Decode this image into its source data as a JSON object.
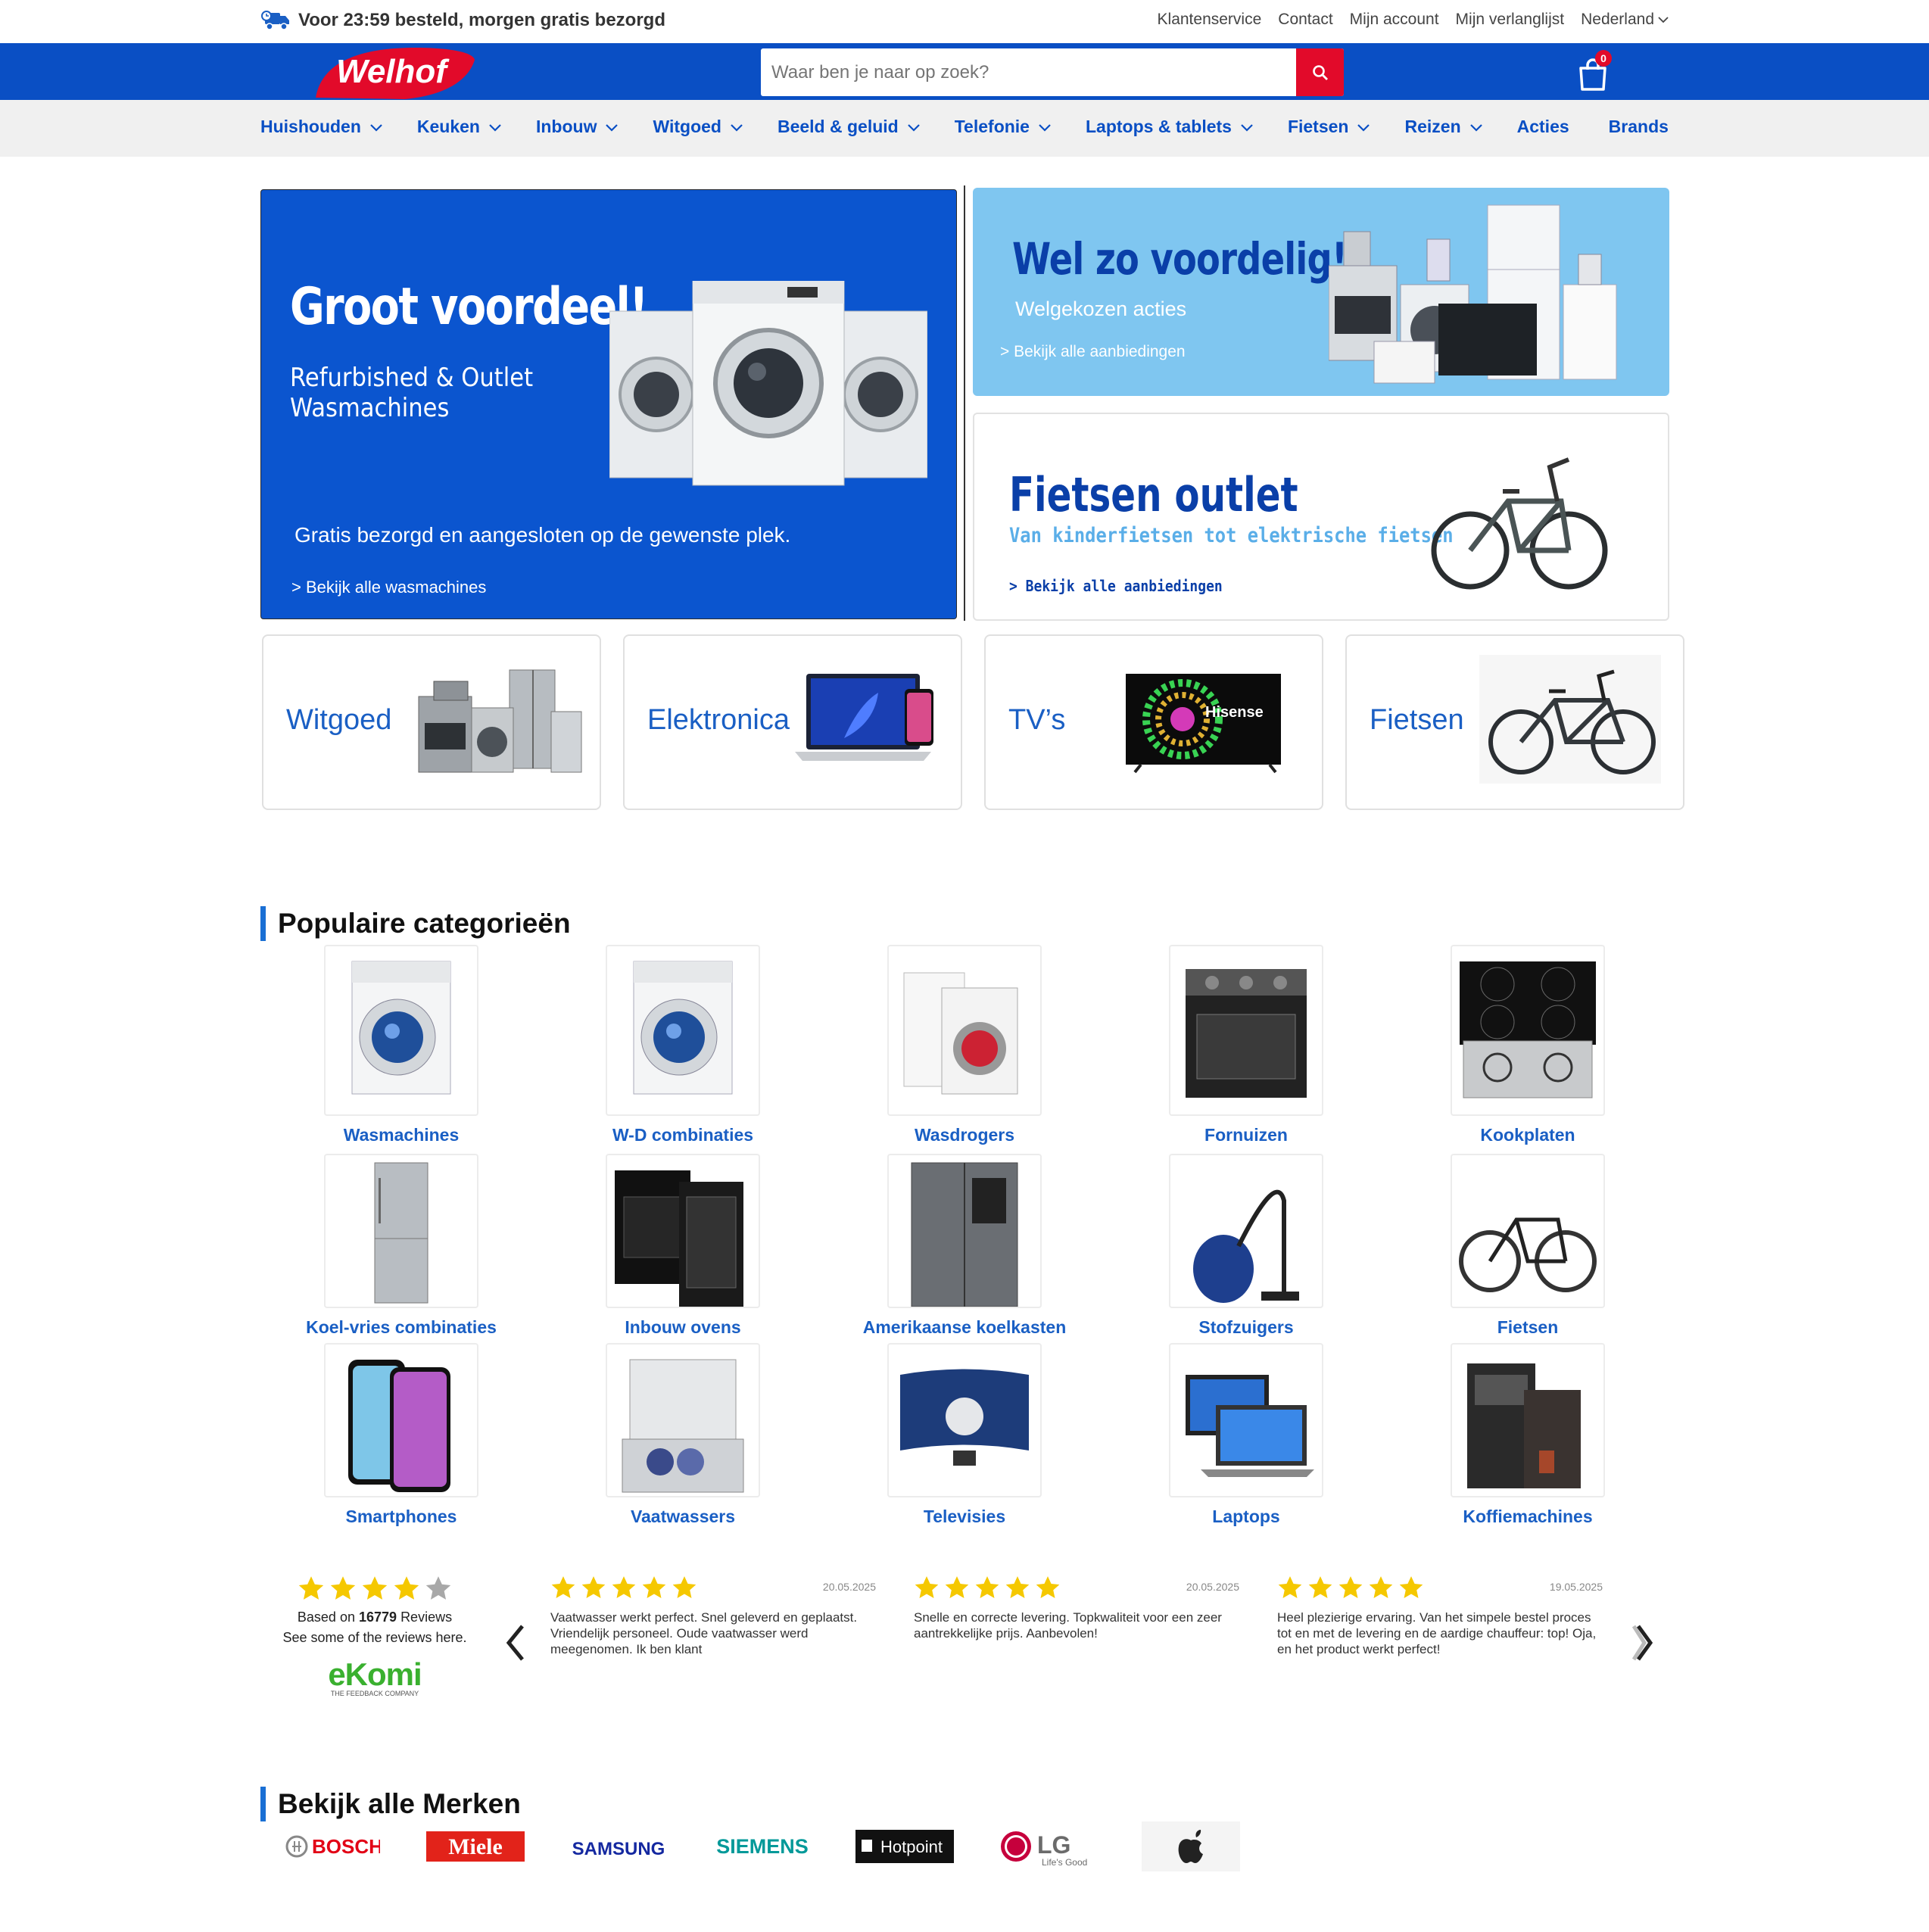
{
  "topbar": {
    "delivery_text": "Voor 23:59 besteld, morgen gratis bezorgd",
    "links": [
      "Klantenservice",
      "Contact",
      "Mijn account",
      "Mijn verlanglijst",
      "Nederland"
    ]
  },
  "header": {
    "logo_text": "Welhof",
    "search_placeholder": "Waar ben je naar op zoek?",
    "cart_count": "0"
  },
  "nav": {
    "items": [
      {
        "label": "Huishouden",
        "dropdown": true
      },
      {
        "label": "Keuken",
        "dropdown": true
      },
      {
        "label": "Inbouw",
        "dropdown": true
      },
      {
        "label": "Witgoed",
        "dropdown": true
      },
      {
        "label": "Beeld & geluid",
        "dropdown": true
      },
      {
        "label": "Telefonie",
        "dropdown": true
      },
      {
        "label": "Laptops & tablets",
        "dropdown": true
      },
      {
        "label": "Fietsen",
        "dropdown": true
      },
      {
        "label": "Reizen",
        "dropdown": true
      },
      {
        "label": "Acties",
        "dropdown": false
      },
      {
        "label": "Brands",
        "dropdown": false
      }
    ]
  },
  "banners": {
    "main": {
      "title": "Groot voordeel!",
      "subtitle_line1": "Refurbished & Outlet",
      "subtitle_line2": "Wasmachines",
      "note": "Gratis bezorgd en aangesloten op de gewenste plek.",
      "link": "> Bekijk alle wasmachines"
    },
    "top_right": {
      "title": "Wel zo voordelig!",
      "subtitle": "Welgekozen acties",
      "link": "> Bekijk alle aanbiedingen"
    },
    "bottom_right": {
      "title": "Fietsen outlet",
      "subtitle": "Van kinderfietsen tot elektrische fietsen",
      "link": "> Bekijk alle aanbiedingen"
    }
  },
  "category_cards": [
    "Witgoed",
    "Elektronica",
    "TV’s",
    "Fietsen"
  ],
  "popular": {
    "title": "Populaire categorieën",
    "items": [
      "Wasmachines",
      "W-D combinaties",
      "Wasdrogers",
      "Fornuizen",
      "Kookplaten",
      "Koel-vries combinaties",
      "Inbouw ovens",
      "Amerikaanse koelkasten",
      "Stofzuigers",
      "Fietsen",
      "Smartphones",
      "Vaatwassers",
      "Televisies",
      "Laptops",
      "Koffiemachines"
    ]
  },
  "reviews": {
    "summary": {
      "rating_stars": 4,
      "based_prefix": "Based on",
      "count": "16779",
      "based_suffix": "Reviews",
      "see": "See some of the reviews here.",
      "provider": "eKomi",
      "provider_tagline": "THE FEEDBACK COMPANY"
    },
    "items": [
      {
        "stars": 5,
        "date": "20.05.2025",
        "text": "Vaatwasser werkt perfect. Snel geleverd en geplaatst. Vriendelijk personeel. Oude vaatwasser werd meegenomen. Ik ben klant"
      },
      {
        "stars": 5,
        "date": "20.05.2025",
        "text": "Snelle en correcte levering. Topkwaliteit voor een zeer aantrekkelijke prijs. Aanbevolen!"
      },
      {
        "stars": 5,
        "date": "19.05.2025",
        "text": "Heel plezierige ervaring. Van het simpele bestel proces tot en met de levering en de aardige chauffeur: top! Oja, en het product werkt perfect!"
      }
    ]
  },
  "brands": {
    "title": "Bekijk alle Merken",
    "items": [
      "BOSCH",
      "Miele",
      "SAMSUNG",
      "SIEMENS",
      "Hotpoint",
      "LG",
      "Life's Good"
    ]
  },
  "colors": {
    "brand_blue": "#0a4fc4",
    "accent_red": "#e20a2a",
    "link_blue": "#1a5fc4",
    "star_yellow": "#f5c800"
  }
}
